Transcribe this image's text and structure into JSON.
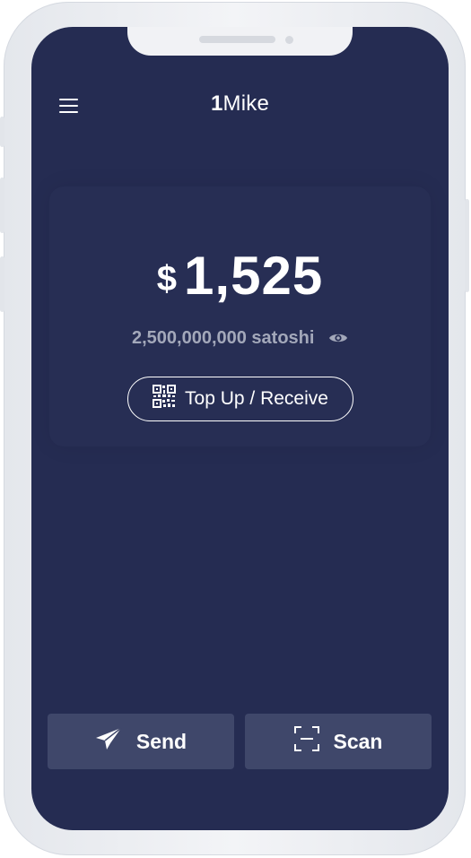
{
  "header": {
    "title_prefix": "1",
    "title_name": "Mike",
    "menu_icon": "hamburger-menu-icon"
  },
  "balance": {
    "currency_symbol": "$",
    "amount": "1,525",
    "satoshi_text": "2,500,000,000 satoshi",
    "visibility_icon": "eye-icon"
  },
  "topup": {
    "label": "Top Up / Receive",
    "icon": "qr-code-icon"
  },
  "actions": {
    "send_label": "Send",
    "send_icon": "paper-plane-icon",
    "scan_label": "Scan",
    "scan_icon": "scan-frame-icon"
  },
  "colors": {
    "screen_background": "#252c52",
    "button_background": "#3f476a",
    "secondary_text": "#a3a8ba"
  }
}
